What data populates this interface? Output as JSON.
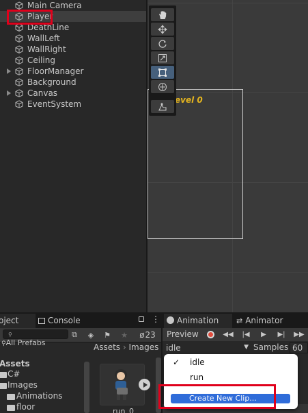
{
  "hierarchy": {
    "items": [
      {
        "name": "Main Camera",
        "expandable": false,
        "selected": false
      },
      {
        "name": "Player",
        "expandable": false,
        "selected": true
      },
      {
        "name": "DeathLine",
        "expandable": false,
        "selected": false
      },
      {
        "name": "WallLeft",
        "expandable": false,
        "selected": false
      },
      {
        "name": "WallRight",
        "expandable": false,
        "selected": false
      },
      {
        "name": "Ceiling",
        "expandable": false,
        "selected": false
      },
      {
        "name": "FloorManager",
        "expandable": true,
        "selected": false
      },
      {
        "name": "Background",
        "expandable": false,
        "selected": false
      },
      {
        "name": "Canvas",
        "expandable": true,
        "selected": false
      },
      {
        "name": "EventSystem",
        "expandable": false,
        "selected": false
      }
    ]
  },
  "scene": {
    "overlay_text": "evel 0",
    "tools": [
      "hand-tool-icon",
      "move-tool-icon",
      "rotate-tool-icon",
      "scale-tool-icon",
      "rect-tool-icon",
      "transform-tool-icon",
      "custom-tool-icon"
    ],
    "active_tool": "rect-tool-icon"
  },
  "tabs": {
    "project": "oject",
    "console": "Console",
    "animation": "Animation",
    "animator": "Animator"
  },
  "project": {
    "search_placeholder": "",
    "hidden_count": "23",
    "tree": {
      "all_prefabs": "All Prefabs",
      "assets": "Assets",
      "items": [
        "C#",
        "Images",
        "Animations",
        "floor"
      ]
    },
    "breadcrumb": [
      "Assets",
      "Images"
    ],
    "asset_label": "run_0"
  },
  "animation": {
    "preview_label": "Preview",
    "clip_selected": "idle",
    "samples_label": "Samples",
    "samples_value": "60",
    "menu": {
      "items": [
        "idle",
        "run"
      ],
      "checked": "idle",
      "create_label": "Create New Clip..."
    }
  },
  "colors": {
    "highlight_red": "#e0001b",
    "menu_highlight": "#2f6cd9",
    "scene_text": "#e5b51f"
  }
}
